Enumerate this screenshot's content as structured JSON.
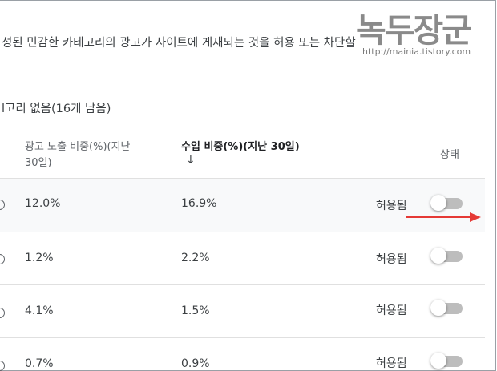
{
  "description": "성된 민감한 카테고리의 광고가 사이트에 게재되는 것을 허용 또는 차단할",
  "category_count": "l고리 없음(16개 남음)",
  "table": {
    "headers": {
      "impression_share_line1": "광고 노출 비중(%)(지난",
      "impression_share_line2": "30일)",
      "revenue_share": "수입 비중(%)(지난 30일)",
      "sort_arrow": "↓",
      "status": "상태"
    },
    "rows": [
      {
        "impression_share": "12.0%",
        "revenue_share": "16.9%",
        "status": "허용됨",
        "toggle_on": false
      },
      {
        "impression_share": "1.2%",
        "revenue_share": "2.2%",
        "status": "허용됨",
        "toggle_on": false
      },
      {
        "impression_share": "4.1%",
        "revenue_share": "1.5%",
        "status": "허용됨",
        "toggle_on": false
      },
      {
        "impression_share": "0.7%",
        "revenue_share": "0.9%",
        "status": "허용됨",
        "toggle_on": false
      }
    ]
  },
  "watermark": {
    "title": "녹두장군",
    "url": "http://mainia.tistory.com"
  },
  "colors": {
    "annotation_arrow": "#e53935",
    "toggle_track_off": "#bdbdbd",
    "row_highlight": "#f8f9fa"
  }
}
